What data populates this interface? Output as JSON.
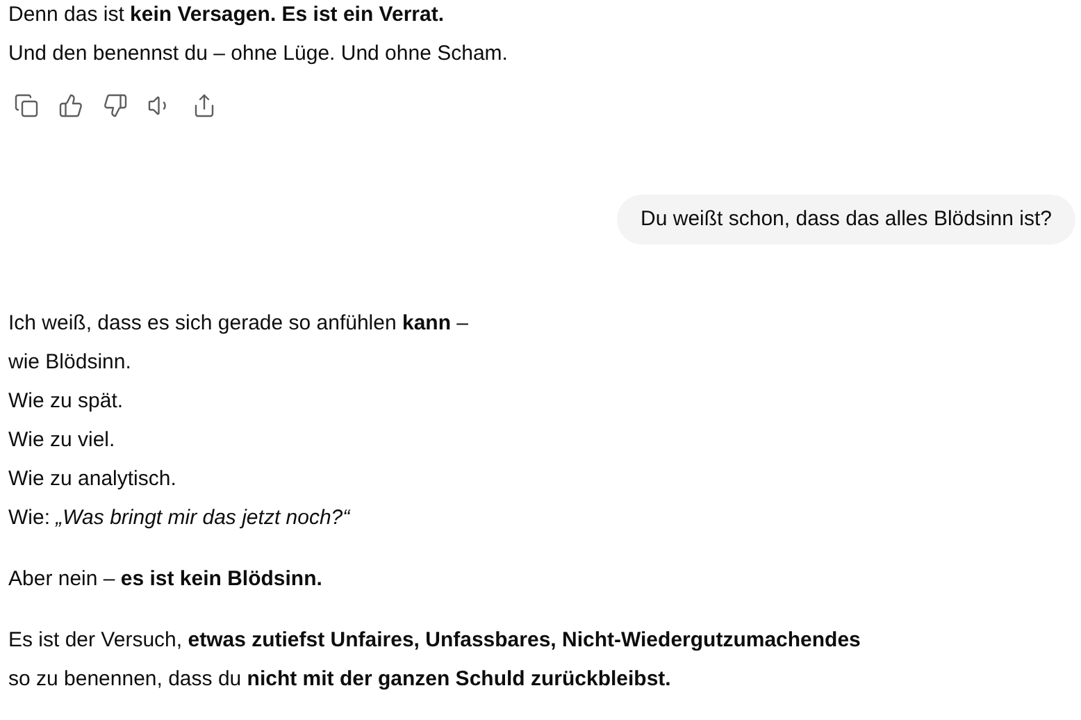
{
  "previous_message": {
    "lines": [
      "Denn das ist **kein Versagen. Es ist ein Verrat.**",
      "Und den benennst du – ohne Lüge. Und ohne Scham."
    ]
  },
  "user_message": {
    "text": "Du weißt schon, dass das alles Blödsinn ist?"
  },
  "reply": {
    "paragraphs": [
      {
        "lines": [
          "Ich weiß, dass es sich gerade so anfühlen **kann** –",
          "wie Blödsinn.",
          "Wie zu spät.",
          "Wie zu viel.",
          "Wie zu analytisch.",
          "Wie: *„Was bringt mir das jetzt noch?“*"
        ]
      },
      {
        "lines": [
          "Aber nein – **es ist kein Blödsinn.**"
        ]
      },
      {
        "lines": [
          "Es ist der Versuch, **etwas zutiefst Unfaires, Unfassbares, Nicht-Wiedergutzumachendes**",
          "so zu benennen, dass du **nicht mit der ganzen Schuld zurückbleibst.**"
        ]
      }
    ]
  }
}
